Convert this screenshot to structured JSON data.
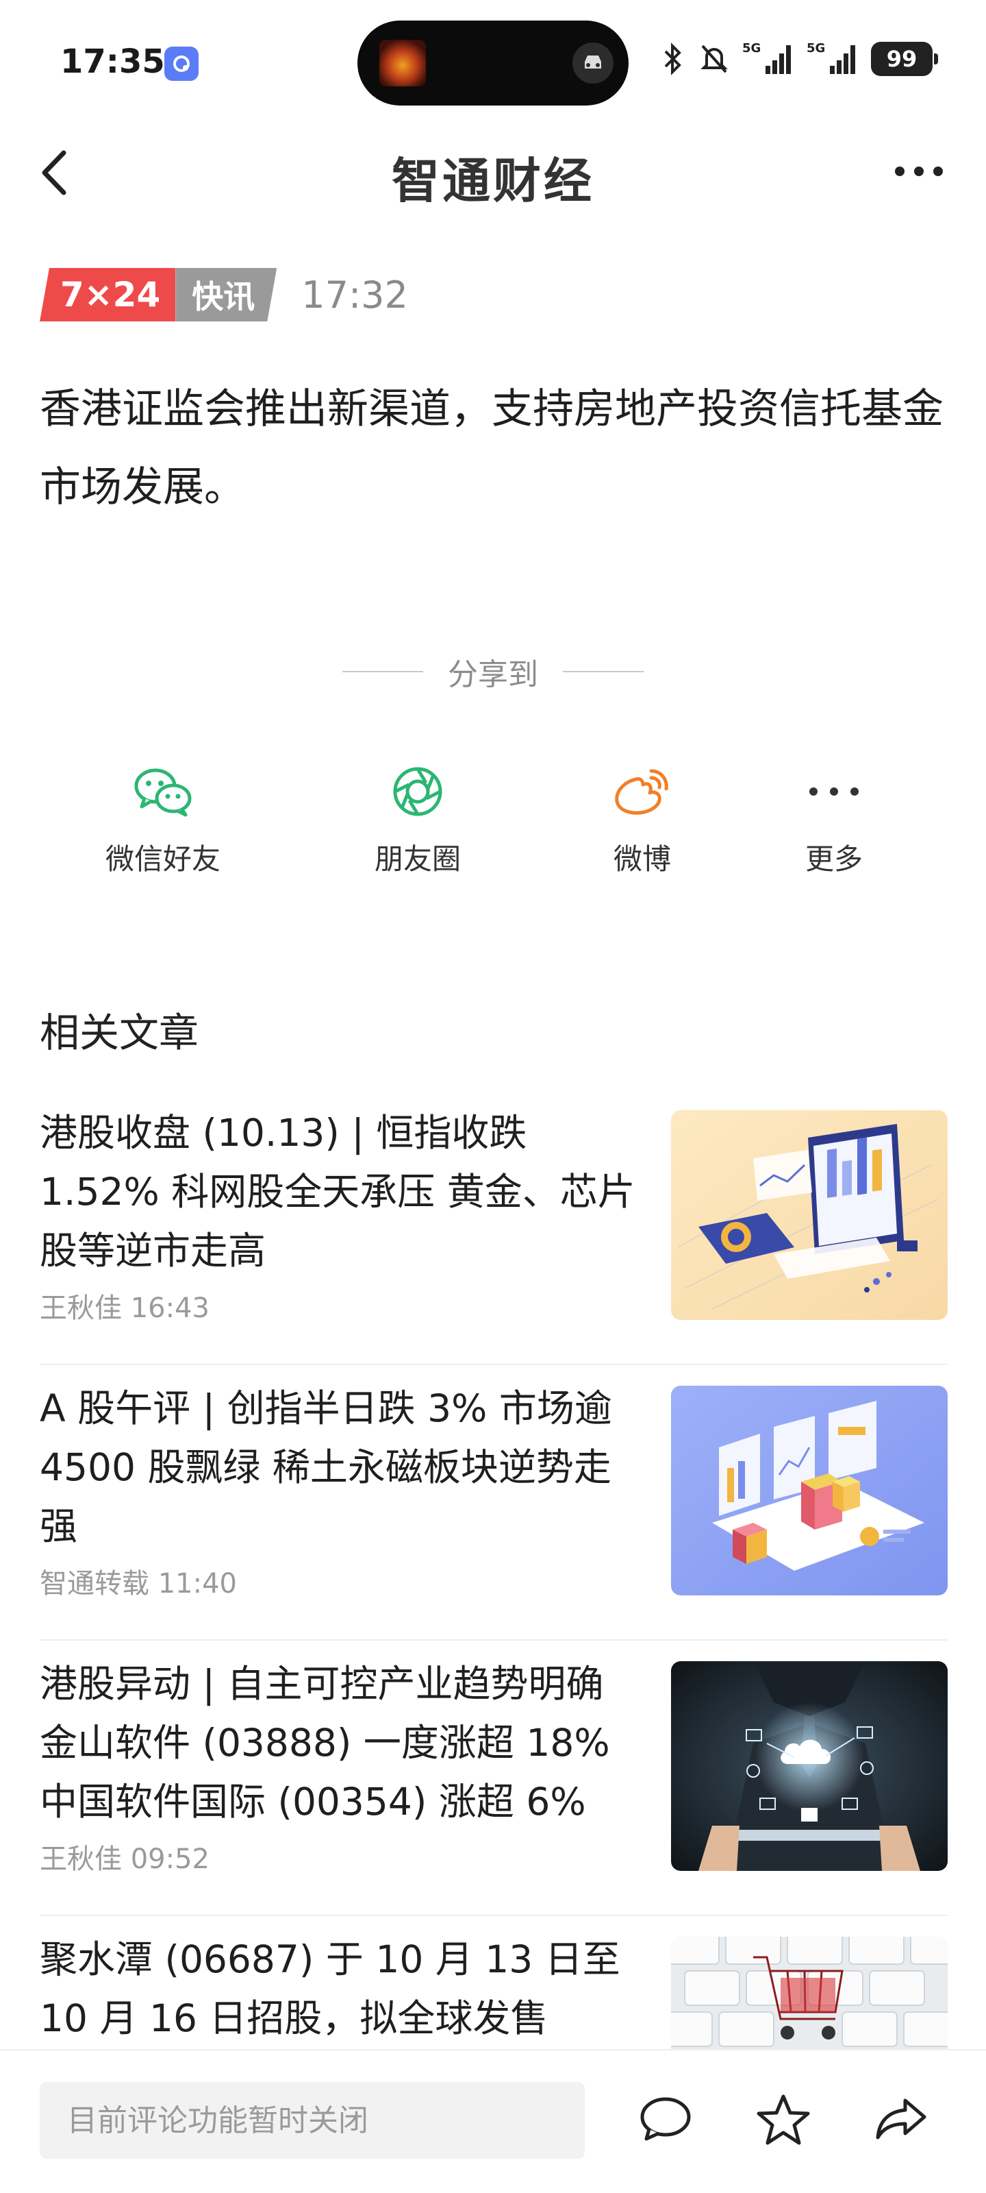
{
  "status_bar": {
    "time": "17:35",
    "battery": "99",
    "network_1": "5G",
    "network_2": "5G"
  },
  "header": {
    "title": "智通财经"
  },
  "flash": {
    "badge_red": "7×24",
    "badge_gray": "快讯",
    "time": "17:32"
  },
  "headline": "香港证监会推出新渠道，支持房地产投资信托基金市场发展。",
  "share": {
    "label": "分享到",
    "items": [
      {
        "label": "微信好友",
        "icon": "wechat-icon"
      },
      {
        "label": "朋友圈",
        "icon": "moments-icon"
      },
      {
        "label": "微博",
        "icon": "weibo-icon"
      },
      {
        "label": "更多",
        "icon": "more-icon"
      }
    ]
  },
  "related": {
    "title": "相关文章",
    "articles": [
      {
        "title": "港股收盘 (10.13) | 恒指收跌 1.52% 科网股全天承压 黄金、芯片股等逆市走高",
        "author": "王秋佳",
        "time": "16:43"
      },
      {
        "title": "A 股午评 | 创指半日跌 3% 市场逾 4500 股飘绿 稀土永磁板块逆势走强",
        "author": "智通转载",
        "time": "11:40"
      },
      {
        "title": "港股异动 | 自主可控产业趋势明确 金山软件 (03888) 一度涨超 18% 中国软件国际 (00354) 涨超 6%",
        "author": "王秋佳",
        "time": "09:52"
      },
      {
        "title": "聚水潭 (06687) 于 10 月 13 日至 10 月 16 日招股，拟全球发售",
        "author": "",
        "time": ""
      }
    ]
  },
  "bottom_bar": {
    "comment_placeholder": "目前评论功能暂时关闭"
  },
  "colors": {
    "flash_red": "#ef4a4a",
    "flash_gray": "#9a9a9a",
    "wechat_green": "#2bb673",
    "weibo_orange": "#f0802a"
  }
}
